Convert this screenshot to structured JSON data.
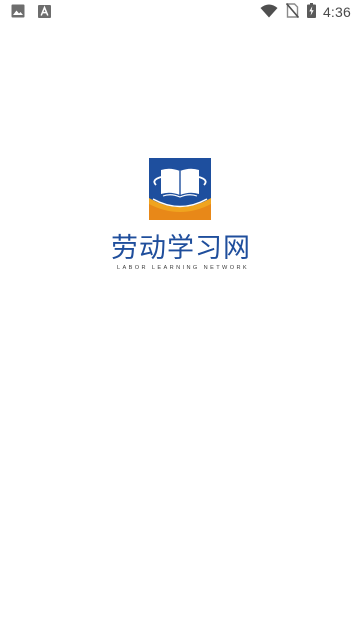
{
  "status_bar": {
    "time": "4:36",
    "left_icons": [
      "image-notification-icon",
      "text-notification-icon"
    ],
    "right_icons": [
      "wifi-icon",
      "no-sim-icon",
      "battery-charging-icon"
    ]
  },
  "splash": {
    "logo_icon": "open-book-icon",
    "title": "劳动学习网",
    "tagline": "LABOR LEARNING NETWORK",
    "colors": {
      "brand_blue": "#1f4e9c",
      "swoosh_orange": "#f0a020",
      "book_white": "#ffffff"
    }
  }
}
